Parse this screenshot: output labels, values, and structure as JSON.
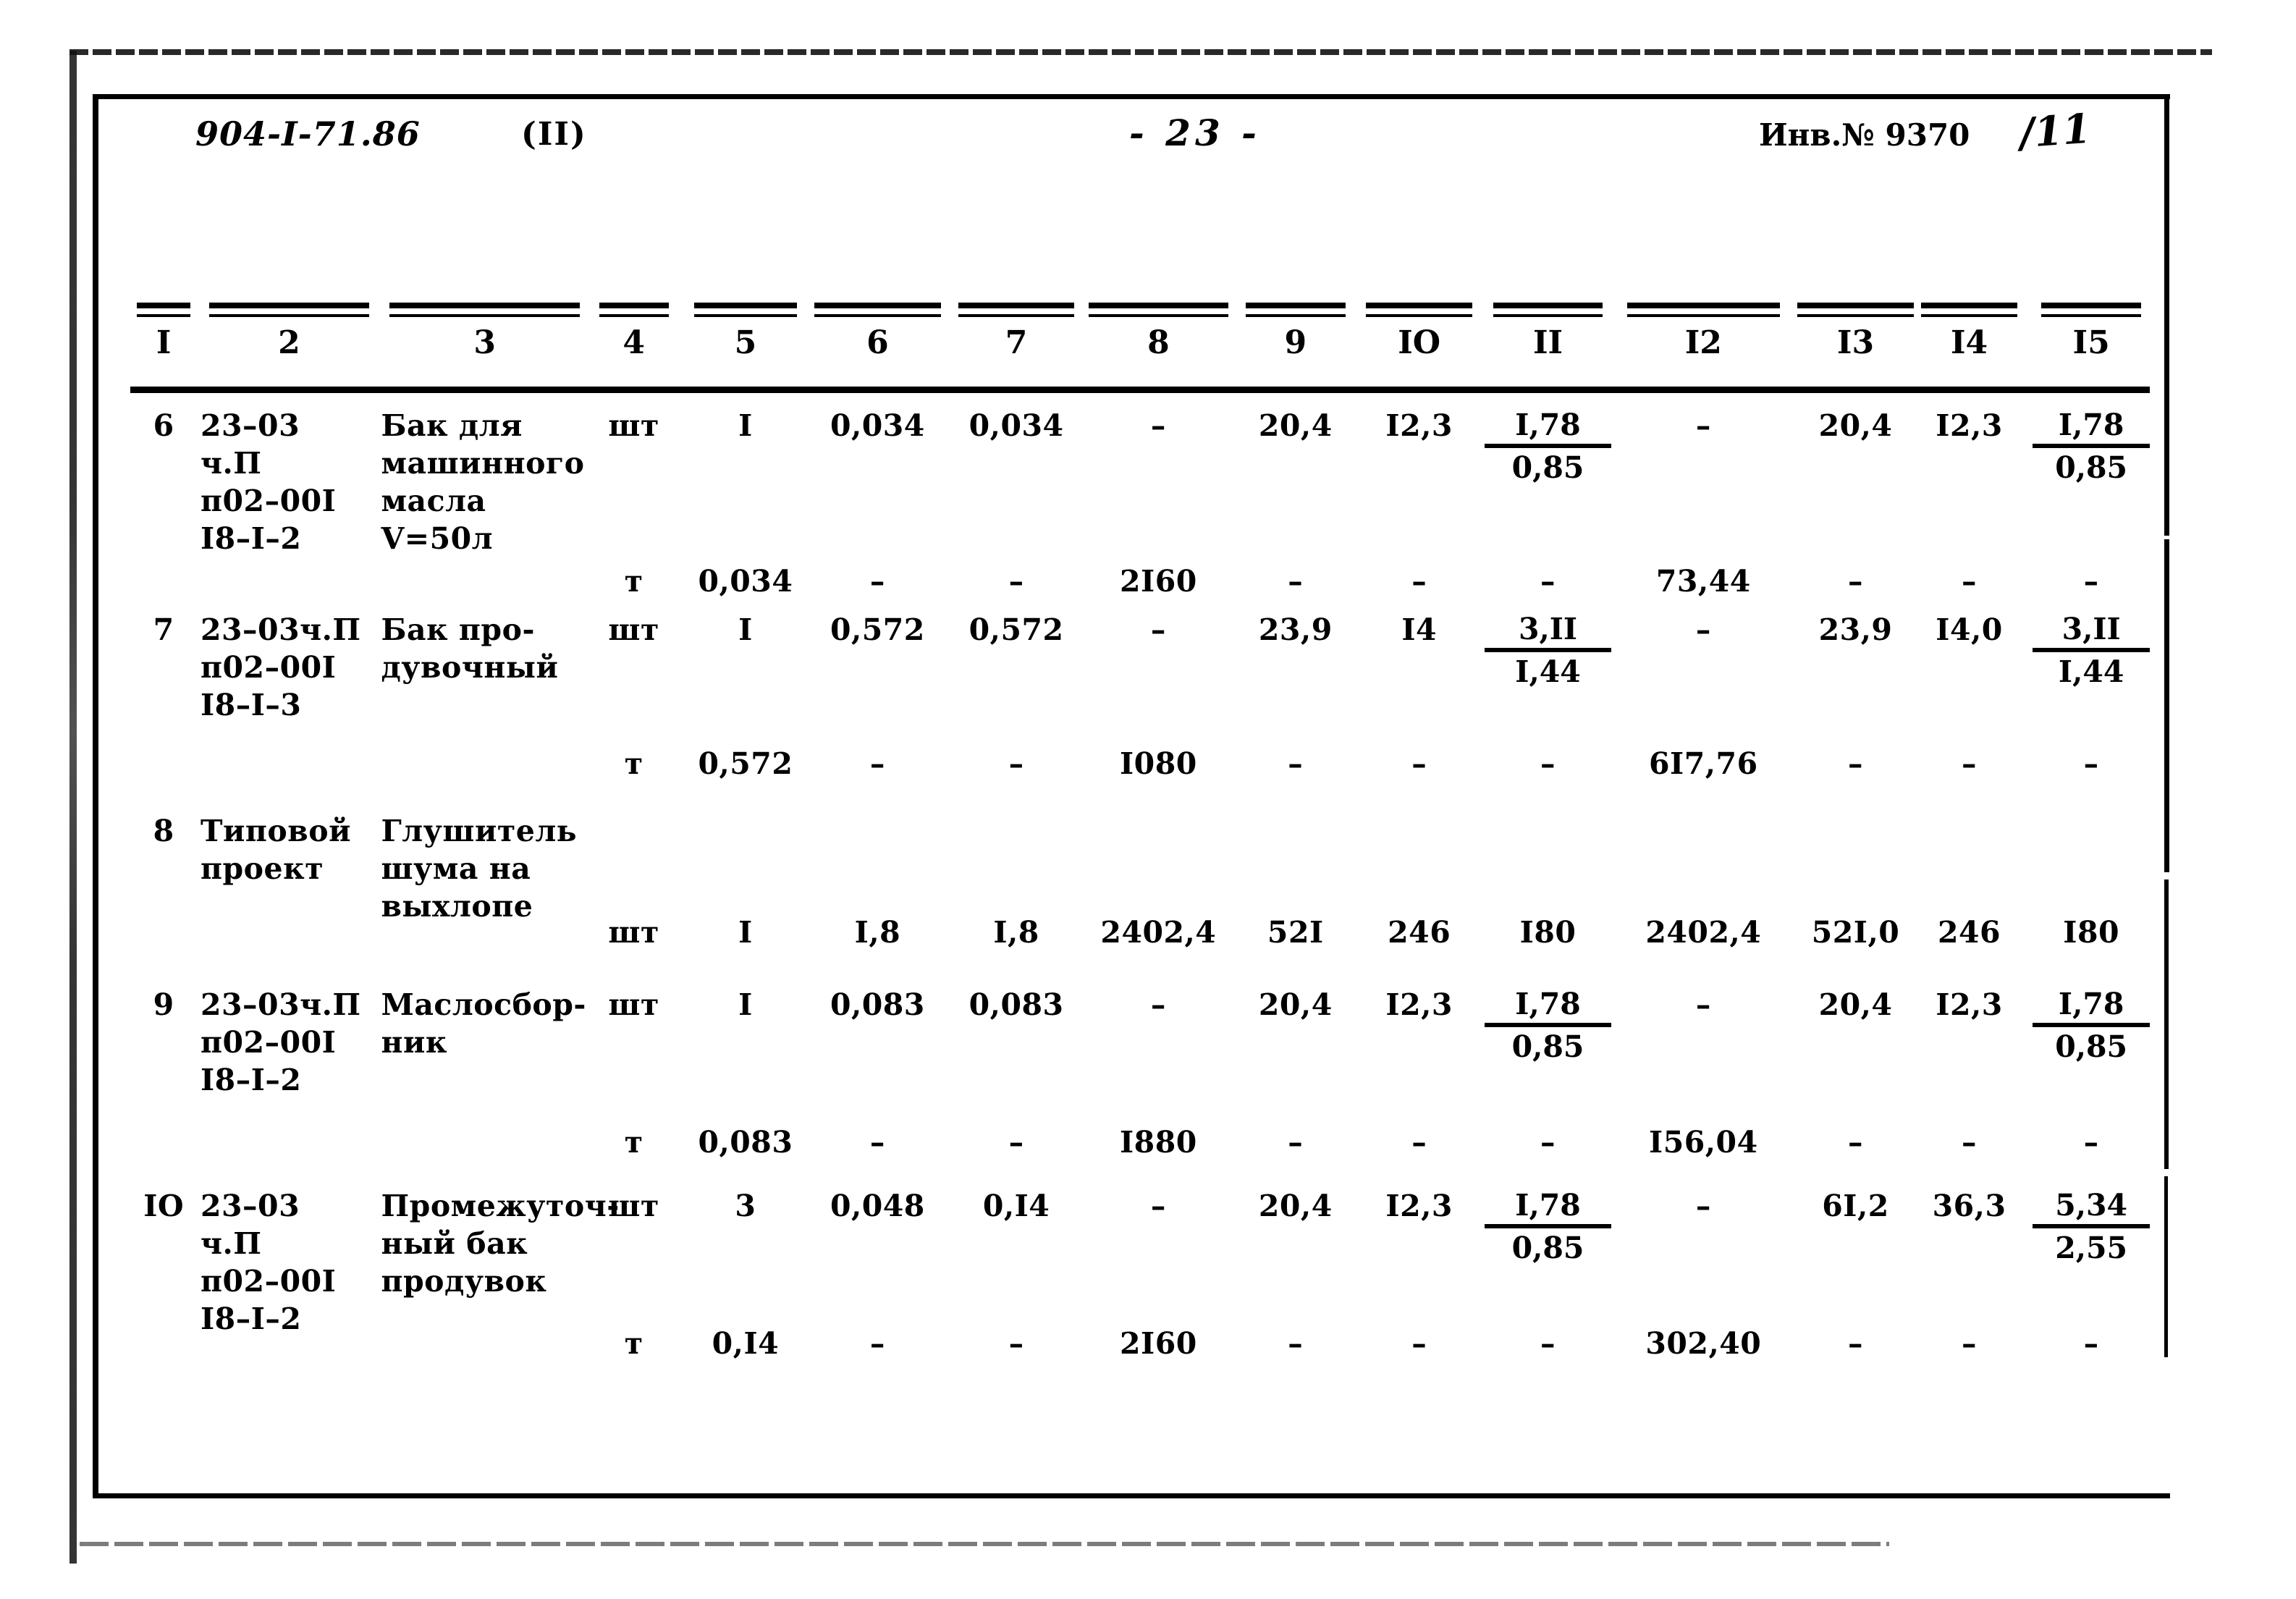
{
  "header": {
    "doc_code": "904-I-71.86",
    "part": "(II)",
    "page_number": "- 23 -",
    "inventory": "Инв.№ 9370",
    "inventory_handwritten": "/11"
  },
  "table": {
    "column_headers": [
      "I",
      "2",
      "3",
      "4",
      "5",
      "6",
      "7",
      "8",
      "9",
      "IO",
      "II",
      "I2",
      "I3",
      "I4",
      "I5"
    ],
    "rows": [
      {
        "num": "6",
        "code": "23–03\nч.П\nп02–00I\nI8–I–2",
        "name": "Бак для\nмашинного\nмасла\nV=50л",
        "lines": [
          {
            "unit": "шт",
            "c5": "I",
            "c6": "0,034",
            "c7": "0,034",
            "c8": "–",
            "c9": "20,4",
            "c10": "I2,3",
            "c11_num": "I,78",
            "c11_den": "0,85",
            "c12": "–",
            "c13": "20,4",
            "c14": "I2,3",
            "c15_num": "I,78",
            "c15_den": "0,85"
          },
          {
            "unit": "т",
            "c5": "0,034",
            "c6": "–",
            "c7": "–",
            "c8": "2I60",
            "c9": "–",
            "c10": "–",
            "c11": "–",
            "c12": "73,44",
            "c13": "–",
            "c14": "–",
            "c15": "–"
          }
        ]
      },
      {
        "num": "7",
        "code": "23–03ч.П\nп02–00I\nI8–I–3",
        "name": "Бак про-\nдувочный",
        "lines": [
          {
            "unit": "шт",
            "c5": "I",
            "c6": "0,572",
            "c7": "0,572",
            "c8": "–",
            "c9": "23,9",
            "c10": "I4",
            "c11_num": "3,II",
            "c11_den": "I,44",
            "c12": "–",
            "c13": "23,9",
            "c14": "I4,0",
            "c15_num": "3,II",
            "c15_den": "I,44"
          },
          {
            "unit": "т",
            "c5": "0,572",
            "c6": "–",
            "c7": "–",
            "c8": "I080",
            "c9": "–",
            "c10": "–",
            "c11": "–",
            "c12": "6I7,76",
            "c13": "–",
            "c14": "–",
            "c15": "–"
          }
        ]
      },
      {
        "num": "8",
        "code": "Типовой\nпроект",
        "name": "Глушитель\nшума на\nвыхлопе",
        "lines": [
          {
            "unit": "шт",
            "c5": "I",
            "c6": "I,8",
            "c7": "I,8",
            "c8": "2402,4",
            "c9": "52I",
            "c10": "246",
            "c11": "I80",
            "c12": "2402,4",
            "c13": "52I,0",
            "c14": "246",
            "c15": "I80"
          }
        ]
      },
      {
        "num": "9",
        "code": "23–03ч.П\nп02–00I\nI8–I–2",
        "name": "Маслосбор-\nник",
        "lines": [
          {
            "unit": "шт",
            "c5": "I",
            "c6": "0,083",
            "c7": "0,083",
            "c8": "–",
            "c9": "20,4",
            "c10": "I2,3",
            "c11_num": "I,78",
            "c11_den": "0,85",
            "c12": "–",
            "c13": "20,4",
            "c14": "I2,3",
            "c15_num": "I,78",
            "c15_den": "0,85"
          },
          {
            "unit": "т",
            "c5": "0,083",
            "c6": "–",
            "c7": "–",
            "c8": "I880",
            "c9": "–",
            "c10": "–",
            "c11": "–",
            "c12": "I56,04",
            "c13": "–",
            "c14": "–",
            "c15": "–"
          }
        ]
      },
      {
        "num": "IO",
        "code": "23–03\nч.П\nп02–00I\nI8–I–2",
        "name": "Промежуточ-\nный бак\nпродувок",
        "lines": [
          {
            "unit": "шт",
            "c5": "3",
            "c6": "0,048",
            "c7": "0,I4",
            "c8": "–",
            "c9": "20,4",
            "c10": "I2,3",
            "c11_num": "I,78",
            "c11_den": "0,85",
            "c12": "–",
            "c13": "6I,2",
            "c14": "36,3",
            "c15_num": "5,34",
            "c15_den": "2,55"
          },
          {
            "unit": "т",
            "c5": "0,I4",
            "c6": "–",
            "c7": "–",
            "c8": "2I60",
            "c9": "–",
            "c10": "–",
            "c11": "–",
            "c12": "302,40",
            "c13": "–",
            "c14": "–",
            "c15": "–"
          }
        ]
      }
    ]
  }
}
